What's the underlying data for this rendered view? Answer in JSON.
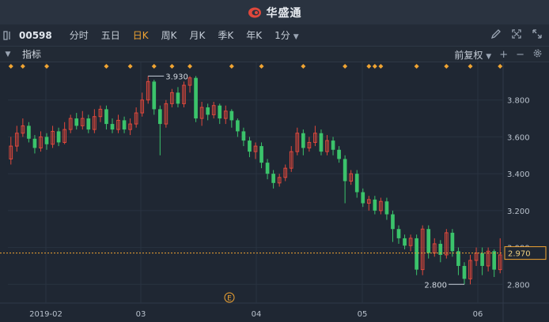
{
  "app": {
    "brand": "华盛通"
  },
  "toolbar": {
    "code": "00598",
    "tabs": [
      {
        "label": "分时",
        "active": false
      },
      {
        "label": "五日",
        "active": false
      },
      {
        "label": "日K",
        "active": true
      },
      {
        "label": "周K",
        "active": false
      },
      {
        "label": "月K",
        "active": false
      },
      {
        "label": "季K",
        "active": false
      },
      {
        "label": "年K",
        "active": false
      },
      {
        "label": "1分",
        "active": false,
        "dropdown": true
      }
    ],
    "icons": [
      "pen-icon",
      "expand-icon",
      "fullscreen-icon"
    ]
  },
  "indicator_bar": {
    "label": "指标",
    "adjust": "前复权",
    "plus": "+",
    "minus": "−"
  },
  "colors": {
    "up": "#e0483c",
    "down": "#3bc36b",
    "accent": "#f0a432",
    "bg": "#1f2733"
  },
  "chart_data": {
    "type": "candlestick",
    "x_tick_labels": [
      "2019-02",
      "03",
      "04",
      "05",
      "06"
    ],
    "y_tick_labels": [
      "3.800",
      "3.600",
      "3.400",
      "3.200",
      "3.000",
      "2.800"
    ],
    "ylim": [
      2.72,
      3.97
    ],
    "current_price": "2.970",
    "max_label": "3.930",
    "min_label": "2.800",
    "event_marker": "E",
    "candles": [
      [
        3.48,
        3.55,
        3.45,
        3.6
      ],
      [
        3.55,
        3.62,
        3.52,
        3.66
      ],
      [
        3.62,
        3.66,
        3.6,
        3.7
      ],
      [
        3.66,
        3.59,
        3.57,
        3.68
      ],
      [
        3.59,
        3.54,
        3.51,
        3.61
      ],
      [
        3.54,
        3.6,
        3.52,
        3.63
      ],
      [
        3.6,
        3.56,
        3.53,
        3.62
      ],
      [
        3.56,
        3.63,
        3.54,
        3.66
      ],
      [
        3.63,
        3.57,
        3.55,
        3.65
      ],
      [
        3.57,
        3.64,
        3.56,
        3.68
      ],
      [
        3.64,
        3.7,
        3.62,
        3.72
      ],
      [
        3.7,
        3.66,
        3.64,
        3.73
      ],
      [
        3.66,
        3.7,
        3.64,
        3.74
      ],
      [
        3.7,
        3.64,
        3.62,
        3.72
      ],
      [
        3.64,
        3.71,
        3.62,
        3.75
      ],
      [
        3.71,
        3.75,
        3.68,
        3.77
      ],
      [
        3.75,
        3.67,
        3.64,
        3.77
      ],
      [
        3.67,
        3.64,
        3.62,
        3.7
      ],
      [
        3.64,
        3.69,
        3.62,
        3.72
      ],
      [
        3.69,
        3.64,
        3.62,
        3.71
      ],
      [
        3.64,
        3.67,
        3.61,
        3.7
      ],
      [
        3.67,
        3.73,
        3.65,
        3.76
      ],
      [
        3.73,
        3.8,
        3.71,
        3.84
      ],
      [
        3.8,
        3.9,
        3.78,
        3.93
      ],
      [
        3.9,
        3.75,
        3.72,
        3.91
      ],
      [
        3.75,
        3.67,
        3.5,
        3.77
      ],
      [
        3.67,
        3.78,
        3.65,
        3.8
      ],
      [
        3.78,
        3.84,
        3.76,
        3.86
      ],
      [
        3.84,
        3.78,
        3.76,
        3.87
      ],
      [
        3.78,
        3.88,
        3.76,
        3.9
      ],
      [
        3.88,
        3.92,
        3.84,
        3.93
      ],
      [
        3.92,
        3.7,
        3.68,
        3.93
      ],
      [
        3.7,
        3.76,
        3.66,
        3.79
      ],
      [
        3.76,
        3.72,
        3.69,
        3.78
      ],
      [
        3.72,
        3.77,
        3.7,
        3.79
      ],
      [
        3.77,
        3.7,
        3.67,
        3.78
      ],
      [
        3.7,
        3.74,
        3.67,
        3.77
      ],
      [
        3.74,
        3.69,
        3.65,
        3.75
      ],
      [
        3.69,
        3.63,
        3.6,
        3.7
      ],
      [
        3.63,
        3.58,
        3.55,
        3.65
      ],
      [
        3.58,
        3.52,
        3.49,
        3.6
      ],
      [
        3.52,
        3.55,
        3.48,
        3.57
      ],
      [
        3.55,
        3.46,
        3.43,
        3.57
      ],
      [
        3.46,
        3.4,
        3.37,
        3.48
      ],
      [
        3.4,
        3.35,
        3.32,
        3.42
      ],
      [
        3.35,
        3.38,
        3.33,
        3.4
      ],
      [
        3.38,
        3.43,
        3.36,
        3.45
      ],
      [
        3.43,
        3.52,
        3.41,
        3.55
      ],
      [
        3.52,
        3.62,
        3.5,
        3.65
      ],
      [
        3.62,
        3.54,
        3.5,
        3.64
      ],
      [
        3.54,
        3.57,
        3.52,
        3.6
      ],
      [
        3.57,
        3.62,
        3.55,
        3.66
      ],
      [
        3.62,
        3.52,
        3.5,
        3.64
      ],
      [
        3.52,
        3.58,
        3.5,
        3.61
      ],
      [
        3.58,
        3.53,
        3.5,
        3.6
      ],
      [
        3.53,
        3.48,
        3.46,
        3.55
      ],
      [
        3.48,
        3.36,
        3.24,
        3.5
      ],
      [
        3.36,
        3.4,
        3.34,
        3.42
      ],
      [
        3.4,
        3.3,
        3.27,
        3.42
      ],
      [
        3.3,
        3.24,
        3.22,
        3.32
      ],
      [
        3.24,
        3.26,
        3.2,
        3.28
      ],
      [
        3.26,
        3.2,
        3.18,
        3.28
      ],
      [
        3.2,
        3.25,
        3.18,
        3.27
      ],
      [
        3.25,
        3.18,
        3.15,
        3.27
      ],
      [
        3.18,
        3.1,
        3.03,
        3.2
      ],
      [
        3.1,
        3.05,
        3.02,
        3.12
      ],
      [
        3.05,
        3.01,
        2.99,
        3.07
      ],
      [
        3.01,
        3.05,
        2.98,
        3.07
      ],
      [
        3.05,
        2.88,
        2.85,
        3.07
      ],
      [
        2.88,
        3.1,
        2.85,
        3.12
      ],
      [
        3.1,
        2.97,
        2.94,
        3.12
      ],
      [
        2.97,
        3.02,
        2.95,
        3.05
      ],
      [
        3.02,
        2.96,
        2.92,
        3.04
      ],
      [
        2.96,
        3.08,
        2.94,
        3.1
      ],
      [
        3.08,
        2.98,
        2.95,
        3.1
      ],
      [
        2.98,
        2.9,
        2.85,
        3.0
      ],
      [
        2.9,
        2.83,
        2.8,
        2.92
      ],
      [
        2.83,
        2.93,
        2.8,
        2.96
      ],
      [
        2.93,
        2.97,
        2.9,
        3.0
      ],
      [
        2.97,
        2.9,
        2.85,
        3.0
      ],
      [
        2.9,
        2.98,
        2.87,
        3.0
      ],
      [
        2.98,
        2.88,
        2.84,
        2.99
      ],
      [
        2.88,
        2.96,
        2.86,
        3.05
      ]
    ],
    "event_markers_x": [
      0,
      2,
      6,
      16,
      20,
      24,
      27,
      30,
      37,
      42,
      49,
      56,
      60,
      61,
      62,
      68,
      73,
      77,
      82
    ]
  }
}
